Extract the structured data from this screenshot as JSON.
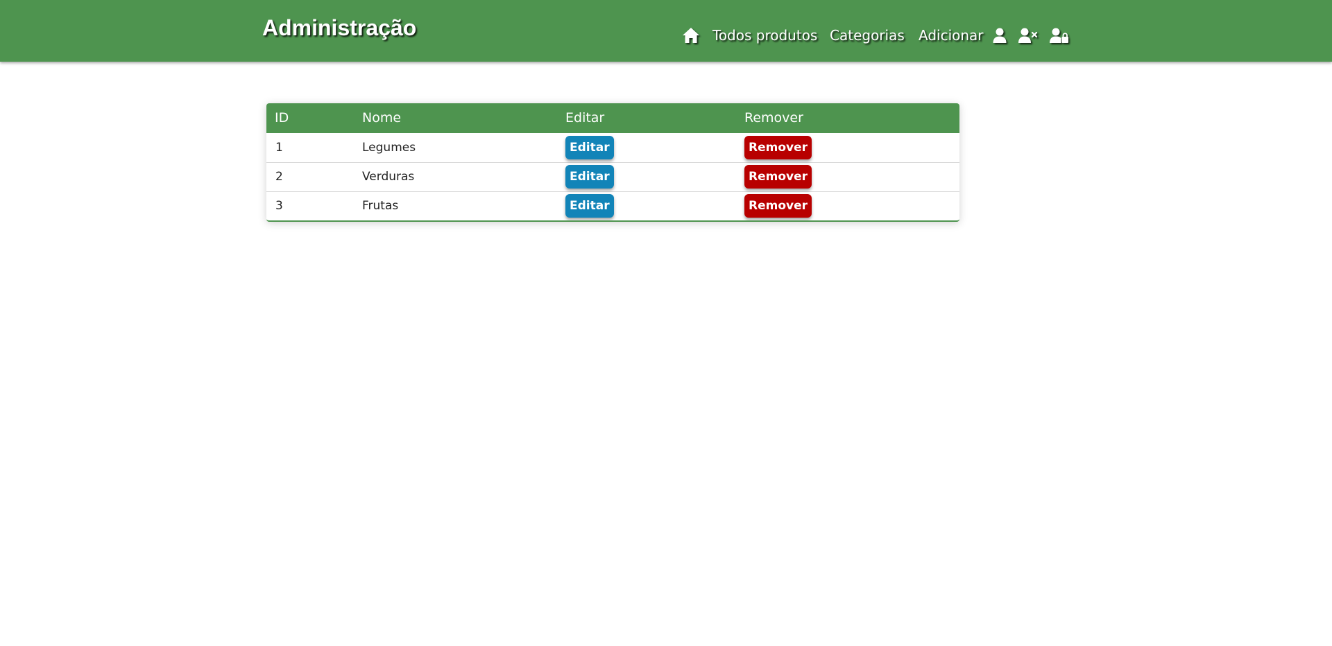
{
  "header": {
    "brand": "Administração",
    "nav": {
      "home_icon": "home-icon",
      "all_products": "Todos produtos",
      "categories": "Categorias",
      "add": "Adicionar",
      "user_icon": "user-icon",
      "user_remove_icon": "user-remove-icon",
      "user_lock_icon": "user-lock-icon"
    }
  },
  "table": {
    "columns": [
      "ID",
      "Nome",
      "Editar",
      "Remover"
    ],
    "rows": [
      {
        "id": "1",
        "name": "Legumes",
        "edit_label": "Editar",
        "remove_label": "Remover"
      },
      {
        "id": "2",
        "name": "Verduras",
        "edit_label": "Editar",
        "remove_label": "Remover"
      },
      {
        "id": "3",
        "name": "Frutas",
        "edit_label": "Editar",
        "remove_label": "Remover"
      }
    ]
  },
  "colors": {
    "header_bg": "#4e944f",
    "edit_button": "#1284b8",
    "remove_button": "#b80000"
  }
}
